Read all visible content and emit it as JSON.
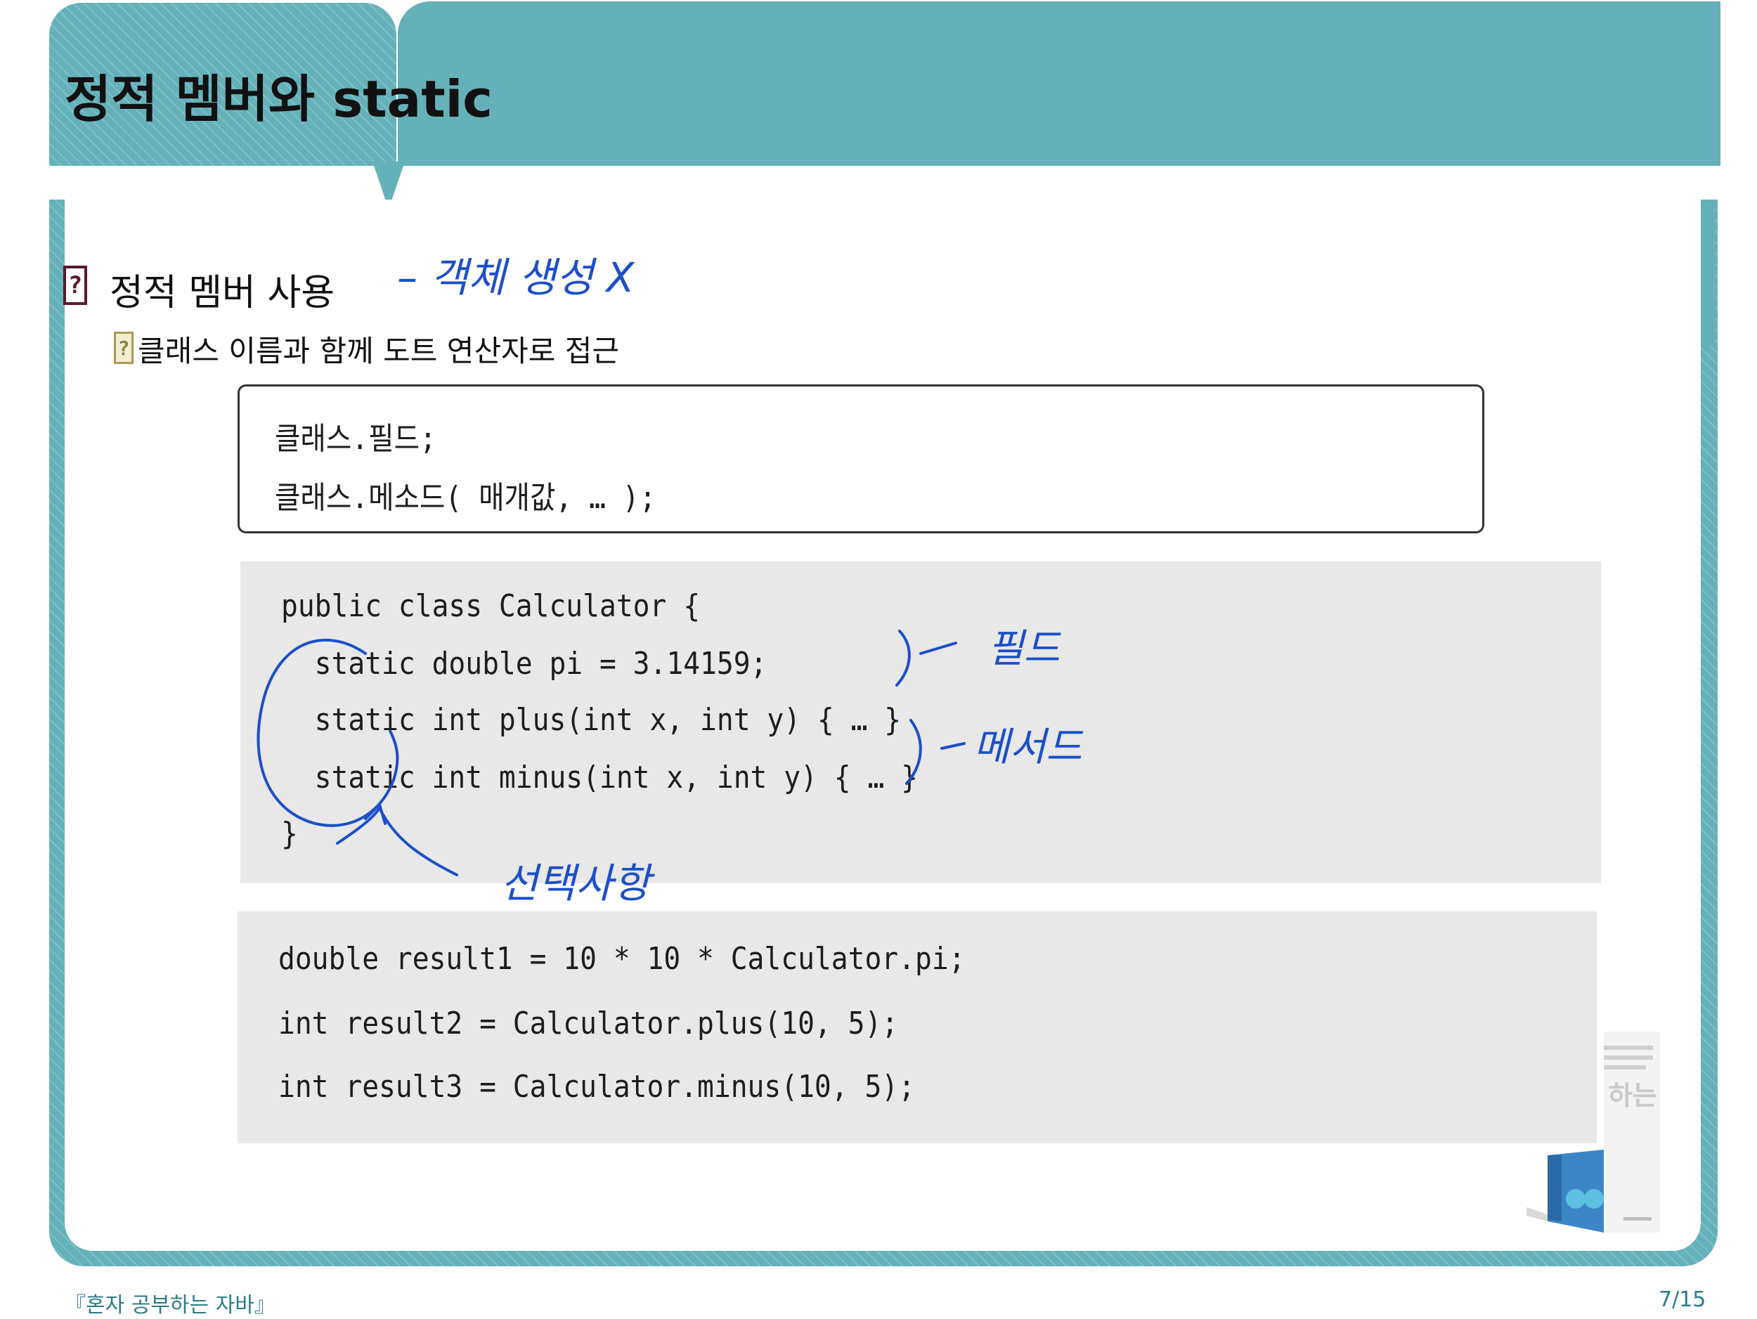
{
  "title": "정적 멤버와 static",
  "section": {
    "heading": "정적 멤버 사용",
    "subheading": "클래스 이름과 함께 도트 연산자로 접근",
    "bullet_icon": "question-icon"
  },
  "syntax_box": {
    "lines": [
      "클래스.필드;",
      "클래스.메소드( 매개값, … );"
    ]
  },
  "code_block_1": {
    "lines": [
      "public class Calculator {",
      "  static double pi = 3.14159;",
      "  static int plus(int x, int y) { … }",
      "  static int minus(int x, int y) { … }",
      "}"
    ]
  },
  "code_block_2": {
    "lines": [
      "double result1 = 10 * 10 * Calculator.pi;",
      "int result2 = Calculator.plus(10, 5);",
      "int result3 = Calculator.minus(10, 5);"
    ]
  },
  "annotations": {
    "heading_note": "– 객체 생성 X",
    "field_note": "필드",
    "method_note": "메서드",
    "static_note": "선택사항"
  },
  "book_cover": {
    "text": "하는"
  },
  "footer": {
    "left": "『혼자 공부하는 자바』",
    "right": "7/15"
  },
  "colors": {
    "header_teal": "#64b1ba",
    "code_background": "#e8e8e8",
    "ink_blue": "#1d4fc9",
    "footer_text": "#2a7c8a"
  }
}
